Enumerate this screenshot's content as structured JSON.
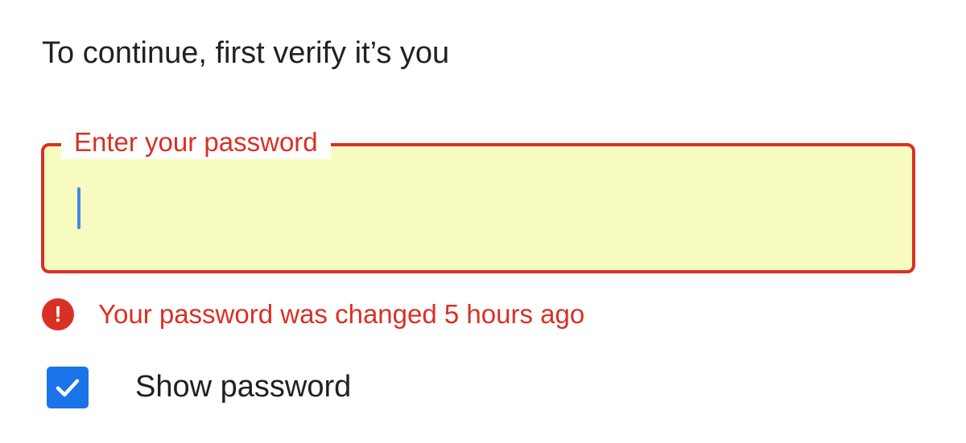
{
  "heading": "To continue, first verify it’s you",
  "password_field": {
    "label": "Enter your password",
    "value": "",
    "state": "error",
    "border_color": "#d93025",
    "fill_color": "#f8fbbf"
  },
  "error": {
    "icon": "error-exclamation-icon",
    "message": "Your password was changed 5 hours ago",
    "color": "#d93025"
  },
  "show_password": {
    "label": "Show password",
    "checked": true,
    "icon": "checkmark-icon",
    "color": "#1a73e8"
  }
}
